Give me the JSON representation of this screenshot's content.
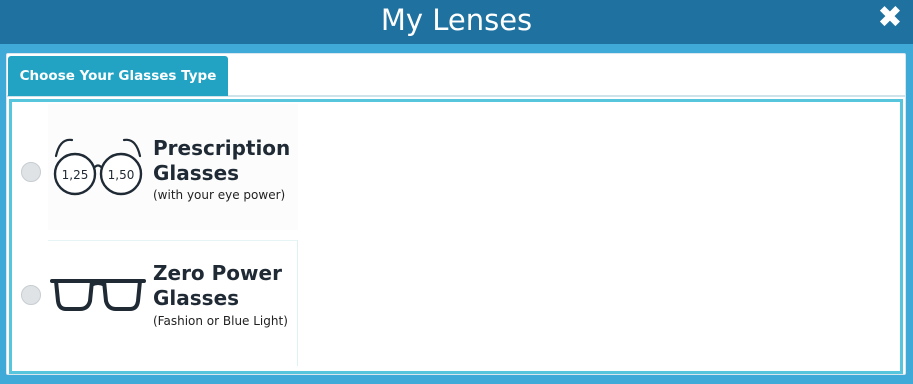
{
  "header": {
    "title": "My Lenses",
    "close_icon": "close-icon"
  },
  "tabs": [
    {
      "label": "Choose Your Glasses Type",
      "active": true
    }
  ],
  "options": [
    {
      "icon": "prescription-glasses-icon",
      "title_line1": "Prescription",
      "title_line2": "Glasses",
      "subtitle": "(with your eye power)",
      "lens_left": "1,25",
      "lens_right": "1,50",
      "selected": false
    },
    {
      "icon": "zero-power-glasses-icon",
      "title_line1": "Zero Power",
      "title_line2": "Glasses",
      "subtitle": "(Fashion or Blue Light)",
      "selected": false
    }
  ],
  "colors": {
    "header_bg": "#1f72a0",
    "page_bg": "#3fa9d7",
    "tab_bg": "#22a3c4",
    "content_border": "#57c6dd"
  }
}
